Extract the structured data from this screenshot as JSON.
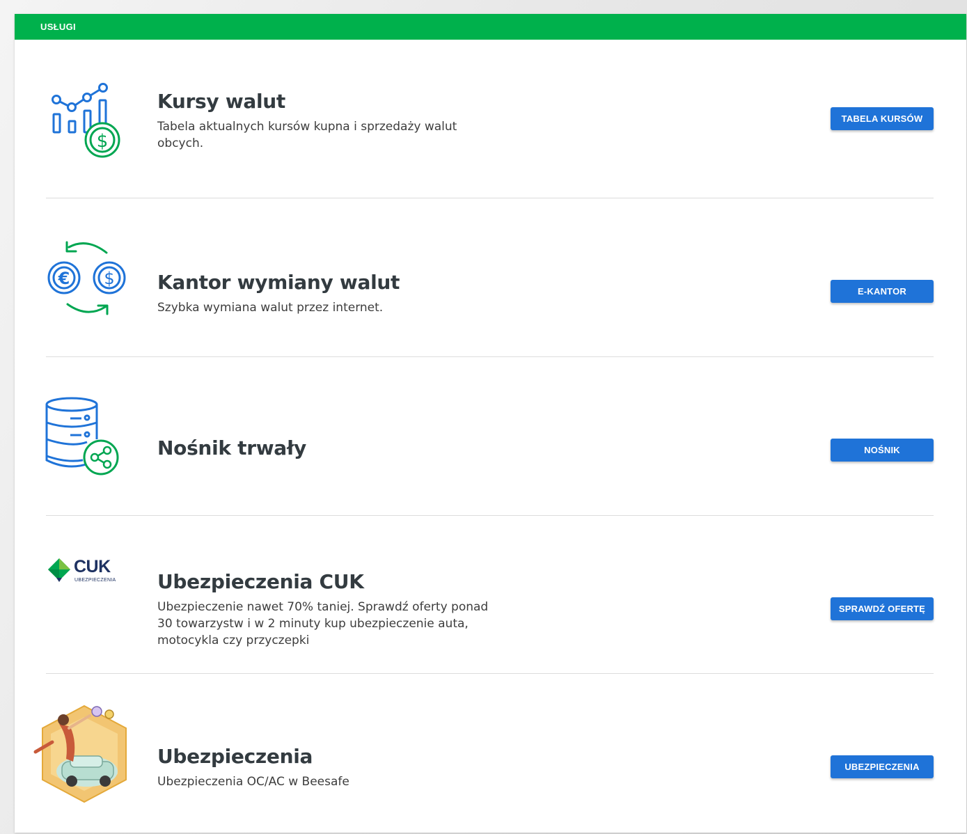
{
  "header": {
    "title": "USŁUGI"
  },
  "colors": {
    "header_green": "#00b14c",
    "button_blue": "#1f73d8",
    "icon_blue": "#1f73d8",
    "icon_green": "#00a651"
  },
  "services": [
    {
      "title": "Kursy walut",
      "description": "Tabela aktualnych kursów kupna i sprzedaży walut obcych.",
      "button": "TABELA KURSÓW",
      "icon": "chart-dollar-icon"
    },
    {
      "title": "Kantor wymiany walut",
      "description": "Szybka wymiana walut przez internet.",
      "button": "E-KANTOR",
      "icon": "currency-exchange-icon"
    },
    {
      "title": "Nośnik trwały",
      "description": "",
      "button": "NOŚNIK",
      "icon": "database-share-icon"
    },
    {
      "title": "Ubezpieczenia CUK",
      "description": "Ubezpieczenie nawet 70% taniej. Sprawdź oferty ponad 30 towarzystw i w 2 minuty kup ubezpieczenie auta, motocykla czy przyczepki",
      "button": "SPRAWDŹ OFERTĘ",
      "icon": "cuk-logo",
      "logo_text": "CUK",
      "logo_subtext": "UBEZPIECZENIA"
    },
    {
      "title": "Ubezpieczenia",
      "description": "Ubezpieczenia OC/AC w Beesafe",
      "button": "UBEZPIECZENIA",
      "icon": "beesafe-illustration-icon"
    }
  ]
}
